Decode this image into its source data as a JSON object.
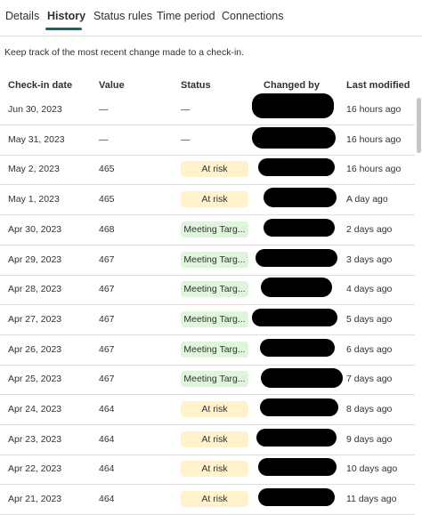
{
  "tabs": [
    {
      "label": "Details",
      "active": false
    },
    {
      "label": "History",
      "active": true
    },
    {
      "label": "Status rules",
      "active": false
    },
    {
      "label": "Time period",
      "active": false
    },
    {
      "label": "Connections",
      "active": false
    }
  ],
  "description": "Keep track of the most recent change made to a check-in.",
  "columns": {
    "date": "Check-in date",
    "value": "Value",
    "status": "Status",
    "changed_by": "Changed by",
    "last_modified": "Last modified"
  },
  "status_colors": {
    "at_risk": "#fff2cc",
    "meeting_target": "#dff6dd",
    "accent": "#0f6c5f"
  },
  "rows": [
    {
      "date": "Jun 30, 2023",
      "value": "—",
      "status": "—",
      "status_type": "none",
      "modified": "16 hours ago"
    },
    {
      "date": "May 31, 2023",
      "value": "—",
      "status": "—",
      "status_type": "none",
      "modified": "16 hours ago"
    },
    {
      "date": "May 2, 2023",
      "value": "465",
      "status": "At risk",
      "status_type": "risk",
      "modified": "16 hours ago"
    },
    {
      "date": "May 1, 2023",
      "value": "465",
      "status": "At risk",
      "status_type": "risk",
      "modified": "A day ago"
    },
    {
      "date": "Apr 30, 2023",
      "value": "468",
      "status": "Meeting Targ...",
      "status_type": "target",
      "modified": "2 days ago"
    },
    {
      "date": "Apr 29, 2023",
      "value": "467",
      "status": "Meeting Targ...",
      "status_type": "target",
      "modified": "3 days ago"
    },
    {
      "date": "Apr 28, 2023",
      "value": "467",
      "status": "Meeting Targ...",
      "status_type": "target",
      "modified": "4 days ago"
    },
    {
      "date": "Apr 27, 2023",
      "value": "467",
      "status": "Meeting Targ...",
      "status_type": "target",
      "modified": "5 days ago"
    },
    {
      "date": "Apr 26, 2023",
      "value": "467",
      "status": "Meeting Targ...",
      "status_type": "target",
      "modified": "6 days ago"
    },
    {
      "date": "Apr 25, 2023",
      "value": "467",
      "status": "Meeting Targ...",
      "status_type": "target",
      "modified": "7 days ago"
    },
    {
      "date": "Apr 24, 2023",
      "value": "464",
      "status": "At risk",
      "status_type": "risk",
      "modified": "8 days ago"
    },
    {
      "date": "Apr 23, 2023",
      "value": "464",
      "status": "At risk",
      "status_type": "risk",
      "modified": "9 days ago"
    },
    {
      "date": "Apr 22, 2023",
      "value": "464",
      "status": "At risk",
      "status_type": "risk",
      "modified": "10 days ago"
    },
    {
      "date": "Apr 21, 2023",
      "value": "464",
      "status": "At risk",
      "status_type": "risk",
      "modified": "11 days ago"
    }
  ]
}
